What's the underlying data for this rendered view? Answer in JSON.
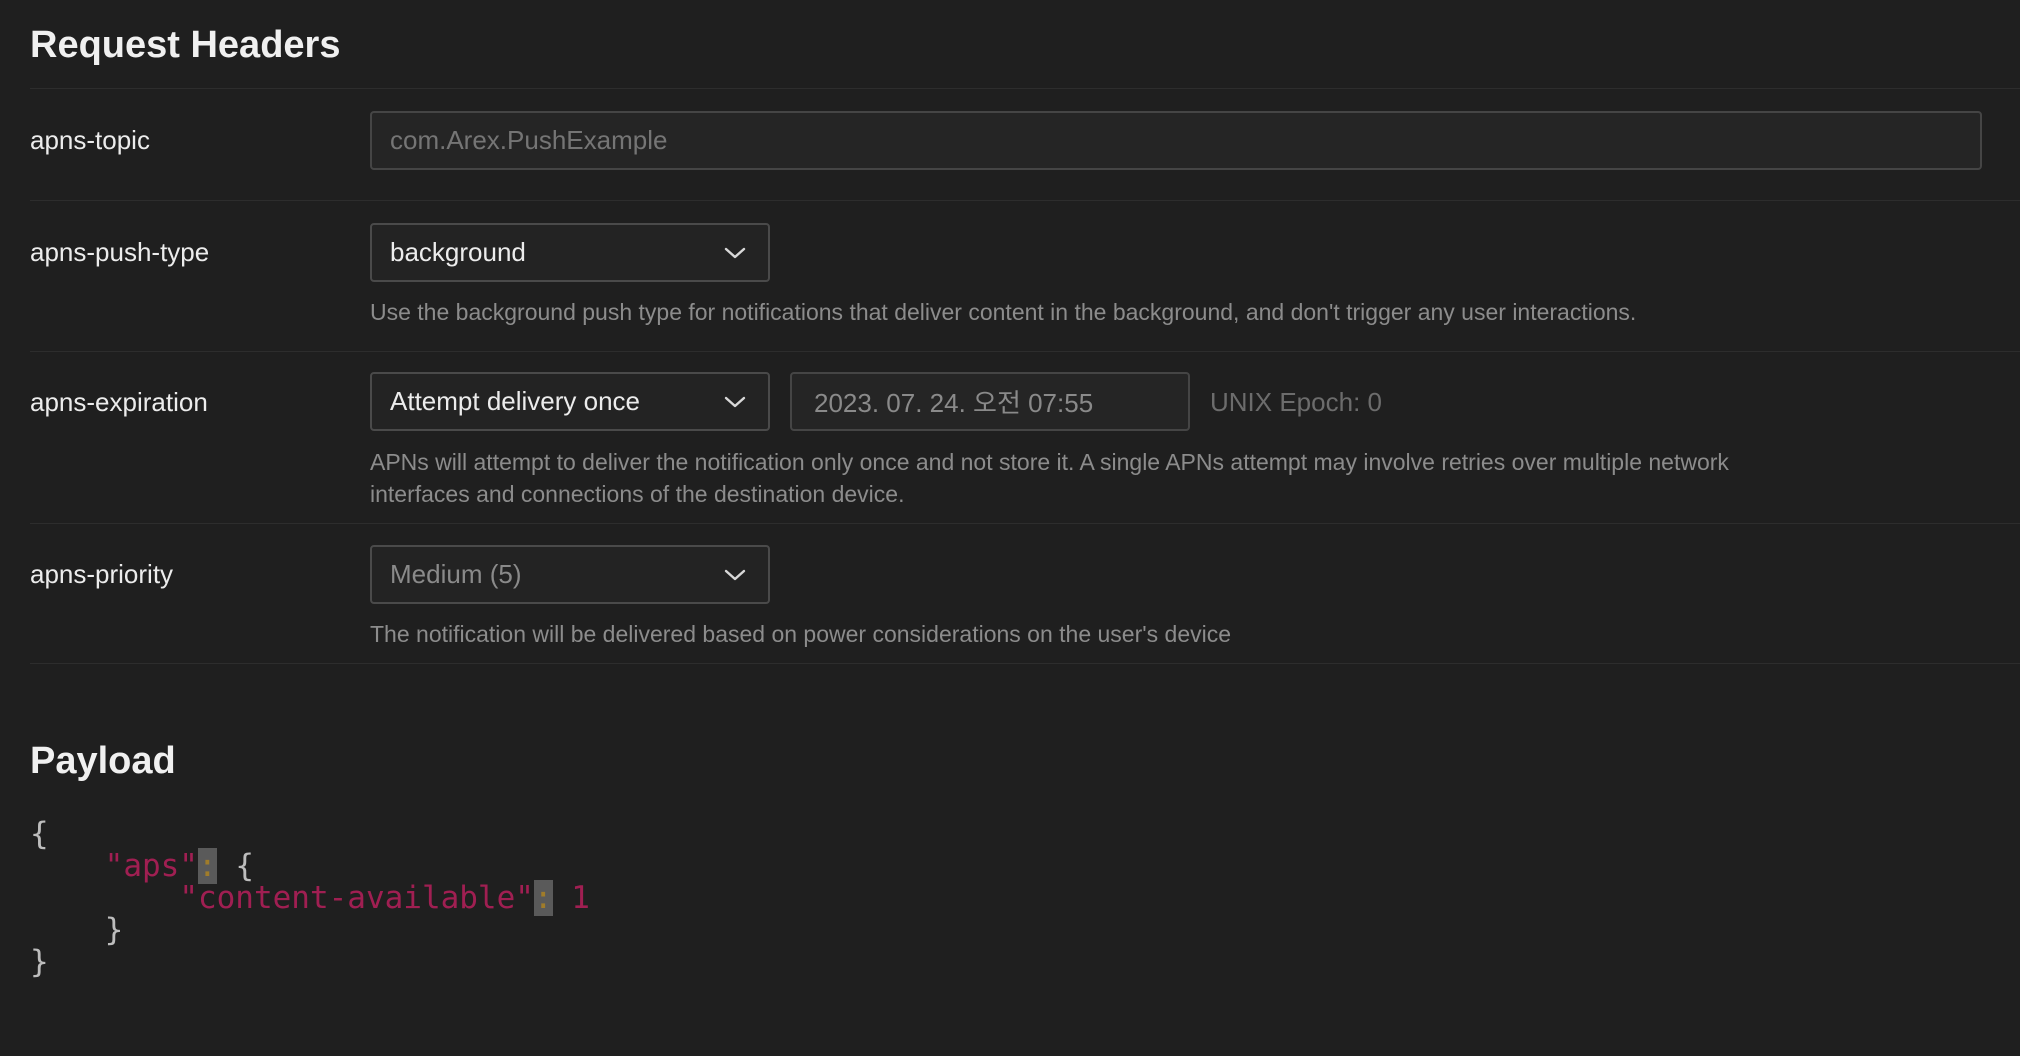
{
  "headers_section": {
    "title": "Request Headers"
  },
  "topic": {
    "label": "apns-topic",
    "placeholder": "com.Arex.PushExample",
    "value": ""
  },
  "push_type": {
    "label": "apns-push-type",
    "selected": "background",
    "help": "Use the background push type for notifications that deliver content in the background, and don't trigger any user interactions."
  },
  "expiration": {
    "label": "apns-expiration",
    "selected": "Attempt delivery once",
    "date_value": "2023. 07. 24. 오전 07:55",
    "epoch_text": "UNIX Epoch: 0",
    "help_line1": "APNs will attempt to deliver the notification only once and not store it. A single APNs attempt may involve retries over multiple network",
    "help_line2": "interfaces and connections of the destination device."
  },
  "priority": {
    "label": "apns-priority",
    "selected": "Medium (5)",
    "help": "The notification will be delivered based on power considerations on the user's device"
  },
  "payload_section": {
    "title": "Payload",
    "open_brace": "{",
    "aps_key": "\"aps\"",
    "colon": ":",
    "aps_open": " {",
    "content_key": "\"content-available\"",
    "content_value": " 1",
    "inner_close": "}",
    "outer_close": "}"
  },
  "icons": {
    "dropdown": "chevron-down-icon"
  },
  "colors": {
    "background": "#1f1f1f",
    "json_key": "#a01f52",
    "json_colon": "#a07c2a"
  }
}
